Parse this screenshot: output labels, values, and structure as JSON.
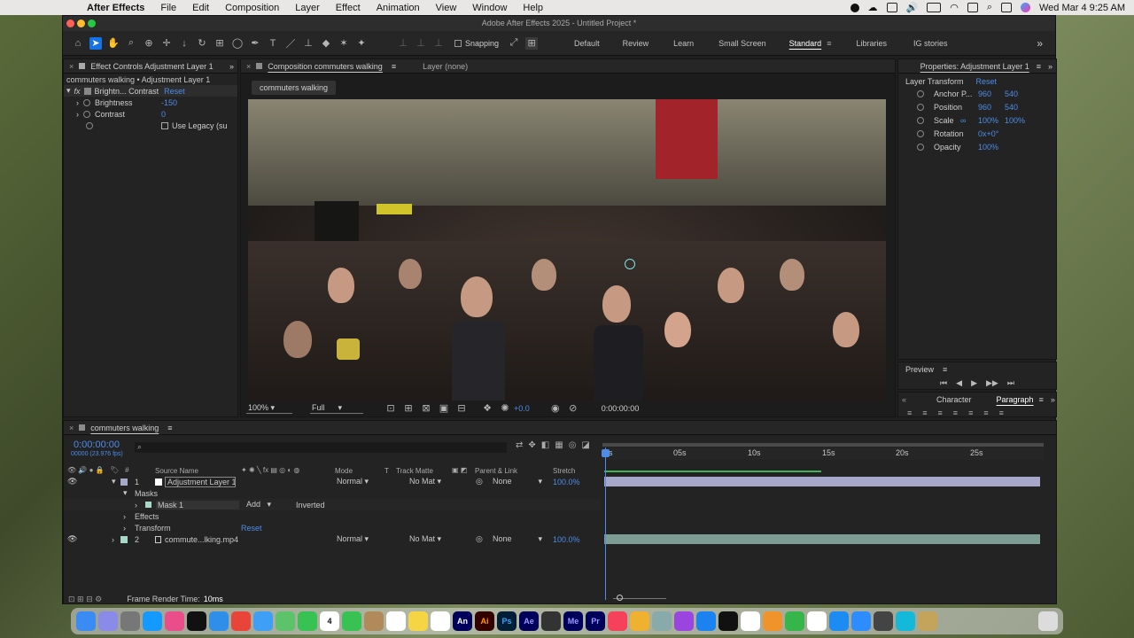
{
  "menubar": {
    "app_name": "After Effects",
    "items": [
      "File",
      "Edit",
      "Composition",
      "Layer",
      "Effect",
      "Animation",
      "View",
      "Window",
      "Help"
    ],
    "clock": "Wed Mar 4  9:25 AM"
  },
  "window": {
    "title": "Adobe After Effects 2025 - Untitled Project *"
  },
  "toolbar": {
    "snapping_label": "Snapping",
    "workspaces": [
      "Default",
      "Review",
      "Learn",
      "Small Screen",
      "Standard",
      "Libraries",
      "IG stories"
    ],
    "current_workspace": "Standard",
    "overflow_glyph": "»"
  },
  "effect_controls": {
    "tab_title": "Effect Controls Adjustment Layer 1",
    "breadcrumb": "commuters walking • Adjustment Layer 1",
    "effect_label": "fx",
    "effect_name": "Brightn... Contrast",
    "reset_label": "Reset",
    "props": [
      {
        "name": "Brightness",
        "value": "-150"
      },
      {
        "name": "Contrast",
        "value": "0"
      }
    ],
    "use_legacy_label": "Use Legacy (su"
  },
  "composition": {
    "tab_title": "Composition commuters walking",
    "layer_tab": "Layer (none)",
    "comp_chip": "commuters walking",
    "zoom": "100%",
    "resolution": "Full",
    "exposure": "+0.0",
    "timecode": "0:00:00:00"
  },
  "properties": {
    "tab_title": "Properties: Adjustment Layer 1",
    "section": "Layer Transform",
    "reset_label": "Reset",
    "rows": [
      {
        "name": "Anchor P...",
        "v1": "960",
        "v2": "540"
      },
      {
        "name": "Position",
        "v1": "960",
        "v2": "540"
      },
      {
        "name": "Scale",
        "v1": "100%",
        "v2": "100%"
      },
      {
        "name": "Rotation",
        "v1": "0x+0°",
        "v2": ""
      },
      {
        "name": "Opacity",
        "v1": "100%",
        "v2": ""
      }
    ]
  },
  "preview": {
    "title": "Preview"
  },
  "char_para": {
    "tabs": [
      "Character",
      "Paragraph"
    ],
    "active": "Paragraph"
  },
  "timeline": {
    "tab_title": "commuters walking",
    "timecode": "0:00:00:00",
    "fps": "00000 (23.976 fps)",
    "search_glyph": "⌕",
    "columns": {
      "source": "Source Name",
      "mode": "Mode",
      "t": "T",
      "track_matte": "Track Matte",
      "parent": "Parent & Link",
      "stretch": "Stretch"
    },
    "ruler": [
      "0s",
      "05s",
      "10s",
      "15s",
      "20s",
      "25s"
    ],
    "layers": [
      {
        "num": "1",
        "name": "Adjustment Layer 1",
        "mode": "Normal",
        "matte": "No Mat",
        "parent": "None",
        "stretch": "100.0%"
      },
      {
        "num": "2",
        "name": "commute...lking.mp4",
        "mode": "Normal",
        "matte": "No Mat",
        "parent": "None",
        "stretch": "100.0%"
      }
    ],
    "sub": {
      "masks": "Masks",
      "mask1": "Mask 1",
      "mask_mode": "Add",
      "inverted": "Inverted",
      "effects": "Effects",
      "transform": "Transform",
      "reset": "Reset"
    },
    "footer_label": "Frame Render Time:",
    "footer_value": "10ms"
  },
  "dock": {
    "apps": [
      {
        "label": "An",
        "color": "#00005b"
      },
      {
        "label": "Ai",
        "color": "#330000"
      },
      {
        "label": "Ps",
        "color": "#001e36"
      },
      {
        "label": "Ae",
        "color": "#00005b"
      },
      {
        "label": "Me",
        "color": "#00005b"
      },
      {
        "label": "Pr",
        "color": "#00005b"
      }
    ],
    "calendar_day": "4"
  },
  "colors": {
    "accent": "#1473e6",
    "param_blue": "#4d8ce8",
    "adj_track": "#a7a7c9",
    "video_track": "#7c9c94"
  }
}
